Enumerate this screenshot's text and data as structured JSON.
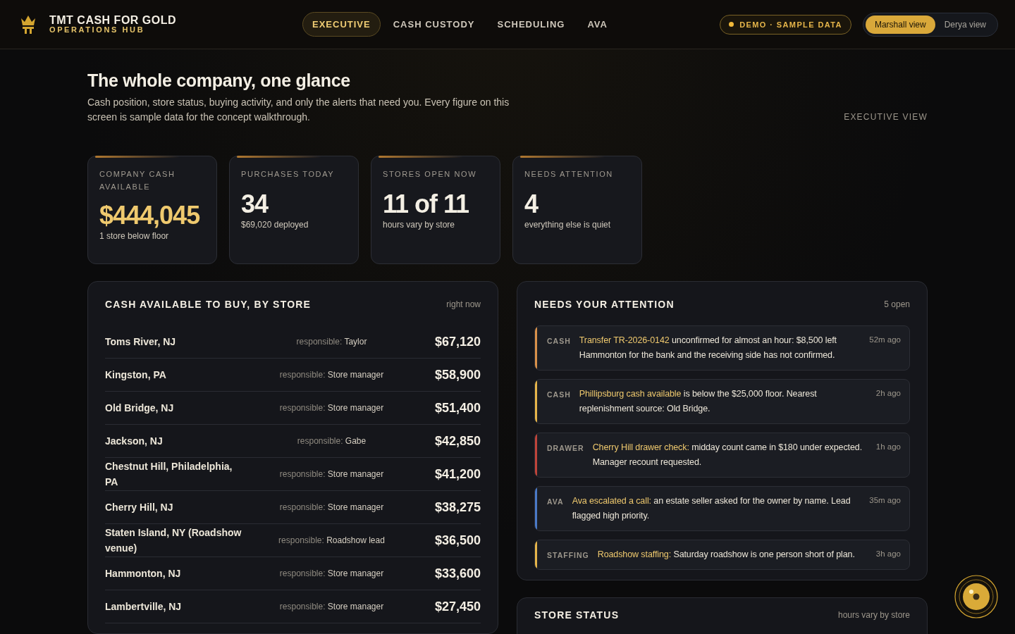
{
  "brand": {
    "title": "TMT CASH FOR GOLD",
    "subtitle": "OPERATIONS HUB"
  },
  "nav": [
    {
      "label": "EXECUTIVE",
      "selected": true
    },
    {
      "label": "CASH CUSTODY",
      "selected": false
    },
    {
      "label": "SCHEDULING",
      "selected": false
    },
    {
      "label": "AVA",
      "selected": false
    }
  ],
  "demo_badge": "DEMO · SAMPLE DATA",
  "view_toggle": [
    {
      "label": "Marshall view",
      "selected": true
    },
    {
      "label": "Derya view",
      "selected": false
    }
  ],
  "hero": {
    "title": "The whole company, one glance",
    "text": "Cash position, store status, buying activity, and only the alerts that need you. Every figure on this screen is sample data for the concept walkthrough.",
    "tag": "EXECUTIVE VIEW"
  },
  "kpis": [
    {
      "label": "COMPANY CASH AVAILABLE",
      "value": "$444,045",
      "note": "1 store below floor",
      "highlight": true
    },
    {
      "label": "PURCHASES TODAY",
      "value": "34",
      "note": "$69,020 deployed",
      "highlight": false
    },
    {
      "label": "STORES OPEN NOW",
      "value": "11 of 11",
      "note": "hours vary by store",
      "highlight": false
    },
    {
      "label": "NEEDS ATTENTION",
      "value": "4",
      "note": "everything else is quiet",
      "highlight": false
    }
  ],
  "cash_panel": {
    "title": "CASH AVAILABLE TO BUY, BY STORE",
    "meta": "right now",
    "rows": [
      {
        "store": "Toms River, NJ",
        "responsible": "responsible: **Taylor**",
        "amount": "$67,120"
      },
      {
        "store": "Kingston, PA",
        "responsible": "responsible: **Store manager**",
        "amount": "$58,900"
      },
      {
        "store": "Old Bridge, NJ",
        "responsible": "responsible: **Store manager**",
        "amount": "$51,400"
      },
      {
        "store": "Jackson, NJ",
        "responsible": "responsible: **Gabe**",
        "amount": "$42,850"
      },
      {
        "store": "Chestnut Hill, Philadelphia, PA",
        "responsible": "responsible: **Store manager**",
        "amount": "$41,200"
      },
      {
        "store": "Cherry Hill, NJ",
        "responsible": "responsible: **Store manager**",
        "amount": "$38,275"
      },
      {
        "store": "Staten Island, NY (Roadshow venue)",
        "responsible": "responsible: **Roadshow lead**",
        "amount": "$36,500"
      },
      {
        "store": "Hammonton, NJ",
        "responsible": "responsible: **Store manager**",
        "amount": "$33,600"
      },
      {
        "store": "Lambertville, NJ",
        "responsible": "responsible: **Store manager**",
        "amount": "$27,450"
      }
    ]
  },
  "attention_panel": {
    "title": "NEEDS YOUR ATTENTION",
    "meta": "5 open",
    "alerts": [
      {
        "category": "CASH",
        "color": "#d9904a",
        "text": "**Transfer TR-2026-0142** unconfirmed for almost an hour: $8,500 left Hammonton for the bank and the receiving side has not confirmed.",
        "time": "52m ago"
      },
      {
        "category": "CASH",
        "color": "#e6b54a",
        "text": "**Phillipsburg cash available** is below the $25,000 floor. Nearest replenishment source: Old Bridge.",
        "time": "2h ago"
      },
      {
        "category": "DRAWER",
        "color": "#c0443a",
        "text": "**Cherry Hill drawer check:** midday count came in $180 under expected. Manager recount requested.",
        "time": "1h ago"
      },
      {
        "category": "AVA",
        "color": "#4a7ac8",
        "text": "**Ava escalated a call:** an estate seller asked for the owner by name. Lead flagged high priority.",
        "time": "35m ago"
      },
      {
        "category": "STAFFING",
        "color": "#e6b54a",
        "text": "**Roadshow staffing:** Saturday roadshow is one person short of plan.",
        "time": "3h ago"
      }
    ]
  },
  "status_panel": {
    "title": "STORE STATUS",
    "meta": "hours vary by store"
  }
}
